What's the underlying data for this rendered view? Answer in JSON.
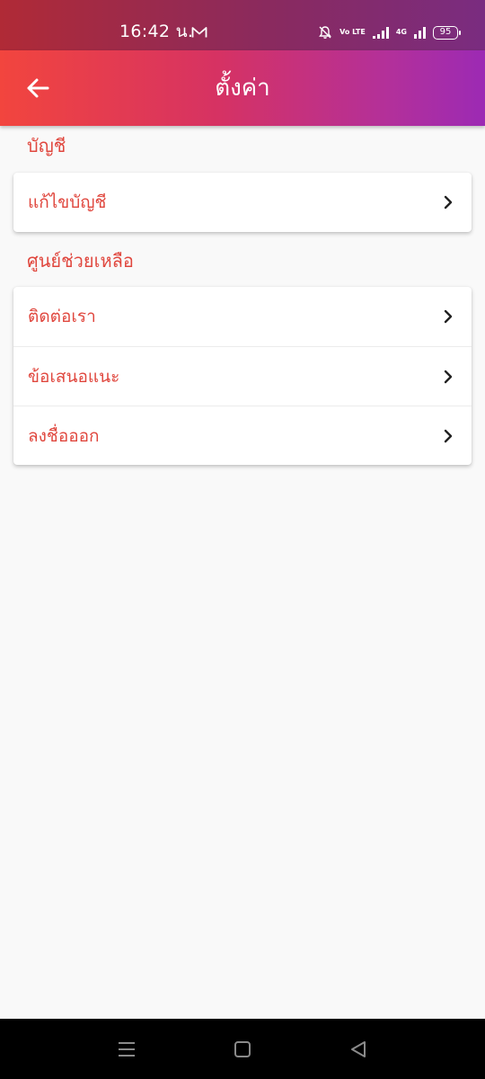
{
  "status_bar": {
    "time": "16:42 น.",
    "volte_label": "Vo LTE",
    "network_label": "4G",
    "battery": "95"
  },
  "app_bar": {
    "title": "ตั้งค่า",
    "back_icon": "arrow-left-icon"
  },
  "sections": [
    {
      "header": "บัญชี",
      "items": [
        {
          "label": "แก้ไขบัญชี",
          "icon": "chevron-right-icon"
        }
      ]
    },
    {
      "header": "ศูนย์ช่วยเหลือ",
      "items": [
        {
          "label": "ติดต่อเรา",
          "icon": "chevron-right-icon"
        },
        {
          "label": "ข้อเสนอแนะ",
          "icon": "chevron-right-icon"
        },
        {
          "label": "ลงชื่อออก",
          "icon": "chevron-right-icon"
        }
      ]
    }
  ],
  "colors": {
    "accent": "#e0473e",
    "app_bar_start": "#f2453e",
    "app_bar_end": "#9c2ab4",
    "background": "#f9f9f9"
  },
  "nav_bar": {
    "icons": [
      "menu-icon",
      "home-square-icon",
      "back-triangle-icon"
    ]
  }
}
